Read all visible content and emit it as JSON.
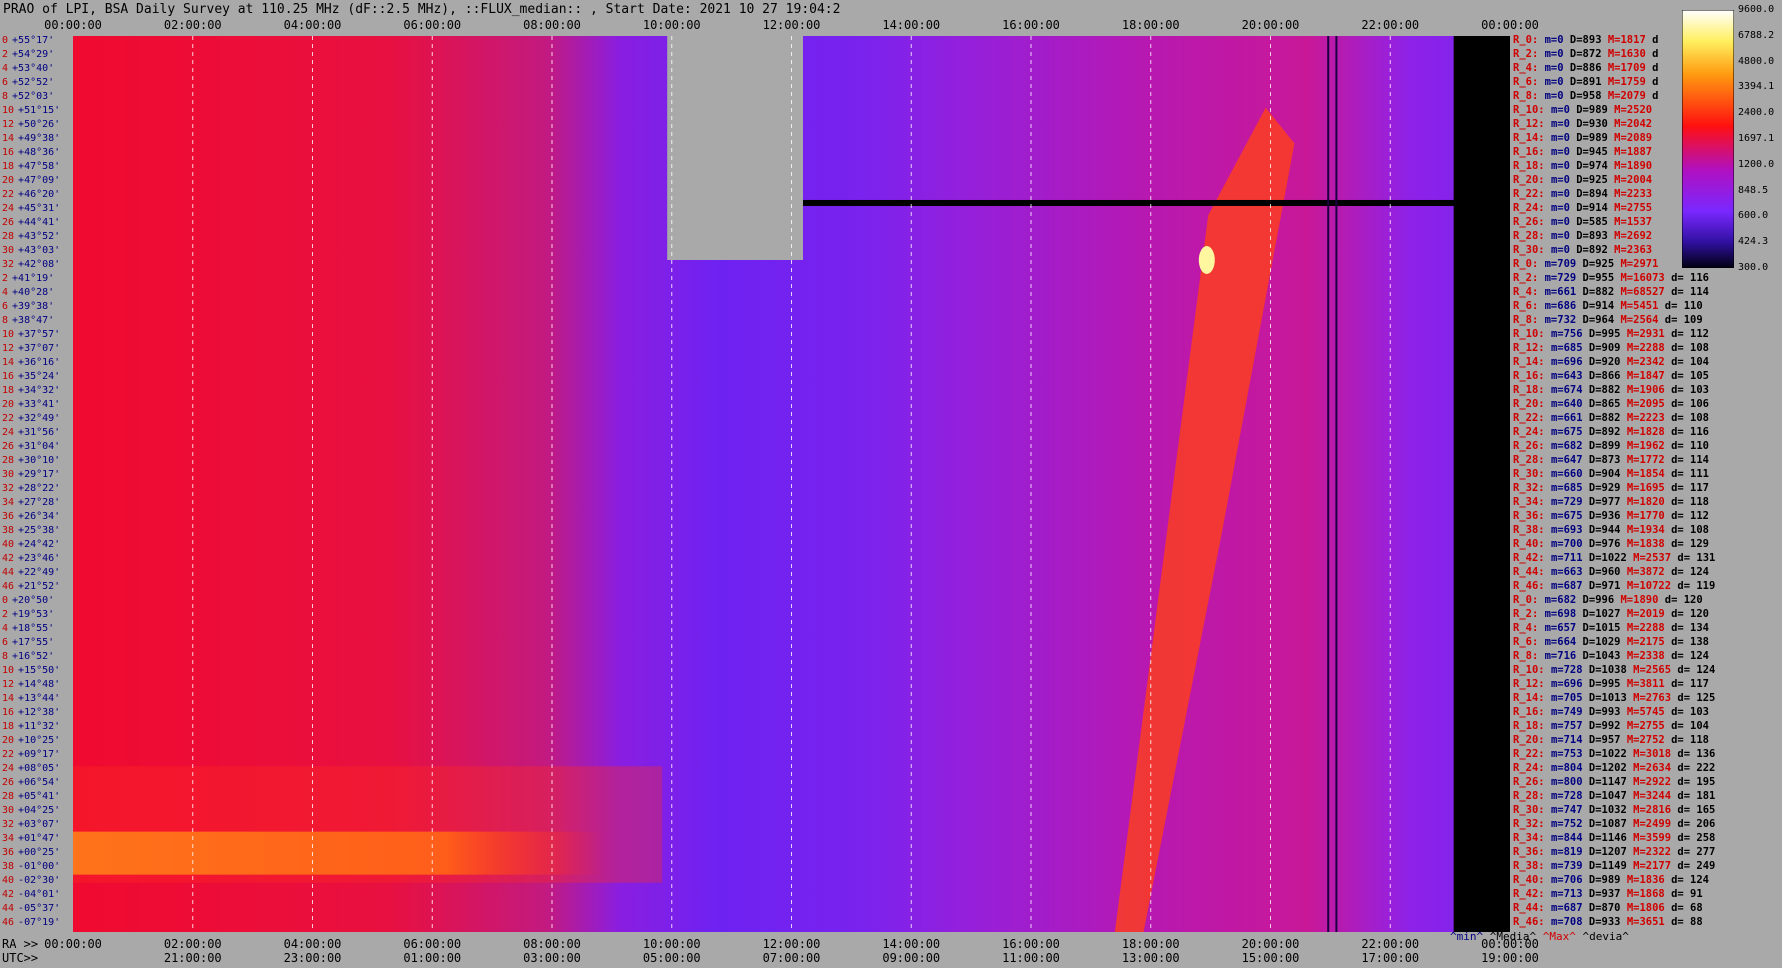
{
  "title": "PRAO of LPI, BSA Daily Survey at 110.25 MHz (dF::2.5 MHz), ::FLUX_median:: , Start Date: 2021 10 27 19:04:2",
  "bottom_left": {
    "ra": "RA >>",
    "utc": "UTC>>"
  },
  "legend_labels": {
    "min": "^min^",
    "median": "^Media^",
    "max": "^Max^",
    "dev": "^devia^"
  },
  "colorbar": {
    "ticks": [
      "9600.0",
      "6788.2",
      "4800.0",
      "3394.1",
      "2400.0",
      "1697.1",
      "1200.0",
      "848.5",
      "600.0",
      "424.3",
      "300.0"
    ]
  },
  "chart_data": {
    "type": "heatmap",
    "x_top_ticks": [
      "00:00:00",
      "02:00:00",
      "04:00:00",
      "06:00:00",
      "08:00:00",
      "10:00:00",
      "12:00:00",
      "14:00:00",
      "16:00:00",
      "18:00:00",
      "20:00:00",
      "22:00:00",
      "00:00:00"
    ],
    "x_bottom_ra_ticks": [
      "00:00:00",
      "02:00:00",
      "04:00:00",
      "06:00:00",
      "08:00:00",
      "10:00:00",
      "12:00:00",
      "14:00:00",
      "16:00:00",
      "18:00:00",
      "20:00:00",
      "22:00:00",
      "00:00:00"
    ],
    "x_bottom_utc_ticks": [
      "21:00:00",
      "23:00:00",
      "01:00:00",
      "03:00:00",
      "05:00:00",
      "07:00:00",
      "09:00:00",
      "11:00:00",
      "13:00:00",
      "15:00:00",
      "17:00:00",
      "19:00:00"
    ],
    "y_ticks": [
      {
        "i": "0",
        "dec": "+55°17'"
      },
      {
        "i": "2",
        "dec": "+54°29'"
      },
      {
        "i": "4",
        "dec": "+53°40'"
      },
      {
        "i": "6",
        "dec": "+52°52'"
      },
      {
        "i": "8",
        "dec": "+52°03'"
      },
      {
        "i": "10",
        "dec": "+51°15'"
      },
      {
        "i": "12",
        "dec": "+50°26'"
      },
      {
        "i": "14",
        "dec": "+49°38'"
      },
      {
        "i": "16",
        "dec": "+48°36'"
      },
      {
        "i": "18",
        "dec": "+47°58'"
      },
      {
        "i": "20",
        "dec": "+47°09'"
      },
      {
        "i": "22",
        "dec": "+46°20'"
      },
      {
        "i": "24",
        "dec": "+45°31'"
      },
      {
        "i": "26",
        "dec": "+44°41'"
      },
      {
        "i": "28",
        "dec": "+43°52'"
      },
      {
        "i": "30",
        "dec": "+43°03'"
      },
      {
        "i": "32",
        "dec": "+42°08'"
      },
      {
        "i": "2",
        "dec": "+41°19'"
      },
      {
        "i": "4",
        "dec": "+40°28'"
      },
      {
        "i": "6",
        "dec": "+39°38'"
      },
      {
        "i": "8",
        "dec": "+38°47'"
      },
      {
        "i": "10",
        "dec": "+37°57'"
      },
      {
        "i": "12",
        "dec": "+37°07'"
      },
      {
        "i": "14",
        "dec": "+36°16'"
      },
      {
        "i": "16",
        "dec": "+35°24'"
      },
      {
        "i": "18",
        "dec": "+34°32'"
      },
      {
        "i": "20",
        "dec": "+33°41'"
      },
      {
        "i": "22",
        "dec": "+32°49'"
      },
      {
        "i": "24",
        "dec": "+31°56'"
      },
      {
        "i": "26",
        "dec": "+31°04'"
      },
      {
        "i": "28",
        "dec": "+30°10'"
      },
      {
        "i": "30",
        "dec": "+29°17'"
      },
      {
        "i": "32",
        "dec": "+28°22'"
      },
      {
        "i": "34",
        "dec": "+27°28'"
      },
      {
        "i": "36",
        "dec": "+26°34'"
      },
      {
        "i": "38",
        "dec": "+25°38'"
      },
      {
        "i": "40",
        "dec": "+24°42'"
      },
      {
        "i": "42",
        "dec": "+23°46'"
      },
      {
        "i": "44",
        "dec": "+22°49'"
      },
      {
        "i": "46",
        "dec": "+21°52'"
      },
      {
        "i": "0",
        "dec": "+20°50'"
      },
      {
        "i": "2",
        "dec": "+19°53'"
      },
      {
        "i": "4",
        "dec": "+18°55'"
      },
      {
        "i": "6",
        "dec": "+17°55'"
      },
      {
        "i": "8",
        "dec": "+16°52'"
      },
      {
        "i": "10",
        "dec": "+15°50'"
      },
      {
        "i": "12",
        "dec": "+14°48'"
      },
      {
        "i": "14",
        "dec": "+13°44'"
      },
      {
        "i": "16",
        "dec": "+12°38'"
      },
      {
        "i": "18",
        "dec": "+11°32'"
      },
      {
        "i": "20",
        "dec": "+10°25'"
      },
      {
        "i": "22",
        "dec": "+09°17'"
      },
      {
        "i": "24",
        "dec": "+08°05'"
      },
      {
        "i": "26",
        "dec": "+06°54'"
      },
      {
        "i": "28",
        "dec": "+05°41'"
      },
      {
        "i": "30",
        "dec": "+04°25'"
      },
      {
        "i": "32",
        "dec": "+03°07'"
      },
      {
        "i": "34",
        "dec": "+01°47'"
      },
      {
        "i": "36",
        "dec": "+00°25'"
      },
      {
        "i": "38",
        "dec": "-01°00'"
      },
      {
        "i": "40",
        "dec": "-02°30'"
      },
      {
        "i": "42",
        "dec": "-04°01'"
      },
      {
        "i": "44",
        "dec": "-05°37'"
      },
      {
        "i": "46",
        "dec": "-07°19'"
      }
    ],
    "stats": [
      {
        "r": "R_0:",
        "m": "m=0",
        "d": "D=893",
        "h": "M=1817",
        "x": "d"
      },
      {
        "r": "R_2:",
        "m": "m=0",
        "d": "D=872",
        "h": "M=1630",
        "x": "d"
      },
      {
        "r": "R_4:",
        "m": "m=0",
        "d": "D=886",
        "h": "M=1709",
        "x": "d"
      },
      {
        "r": "R_6:",
        "m": "m=0",
        "d": "D=891",
        "h": "M=1759",
        "x": "d"
      },
      {
        "r": "R_8:",
        "m": "m=0",
        "d": "D=958",
        "h": "M=2079",
        "x": "d"
      },
      {
        "r": "R_10:",
        "m": "m=0",
        "d": "D=989",
        "h": "M=2520",
        "x": ""
      },
      {
        "r": "R_12:",
        "m": "m=0",
        "d": "D=930",
        "h": "M=2042",
        "x": ""
      },
      {
        "r": "R_14:",
        "m": "m=0",
        "d": "D=989",
        "h": "M=2089",
        "x": ""
      },
      {
        "r": "R_16:",
        "m": "m=0",
        "d": "D=945",
        "h": "M=1887",
        "x": ""
      },
      {
        "r": "R_18:",
        "m": "m=0",
        "d": "D=974",
        "h": "M=1890",
        "x": ""
      },
      {
        "r": "R_20:",
        "m": "m=0",
        "d": "D=925",
        "h": "M=2004",
        "x": ""
      },
      {
        "r": "R_22:",
        "m": "m=0",
        "d": "D=894",
        "h": "M=2233",
        "x": ""
      },
      {
        "r": "R_24:",
        "m": "m=0",
        "d": "D=914",
        "h": "M=2755",
        "x": ""
      },
      {
        "r": "R_26:",
        "m": "m=0",
        "d": "D=585",
        "h": "M=1537",
        "x": ""
      },
      {
        "r": "R_28:",
        "m": "m=0",
        "d": "D=893",
        "h": "M=2692",
        "x": ""
      },
      {
        "r": "R_30:",
        "m": "m=0",
        "d": "D=892",
        "h": "M=2363",
        "x": ""
      },
      {
        "r": "R_0:",
        "m": "m=709",
        "d": "D=925",
        "h": "M=2971",
        "x": ""
      },
      {
        "r": "R_2:",
        "m": "m=729",
        "d": "D=955",
        "h": "M=16073",
        "x": "d= 116"
      },
      {
        "r": "R_4:",
        "m": "m=661",
        "d": "D=882",
        "h": "M=68527",
        "x": "d= 114"
      },
      {
        "r": "R_6:",
        "m": "m=686",
        "d": "D=914",
        "h": "M=5451",
        "x": "d= 110"
      },
      {
        "r": "R_8:",
        "m": "m=732",
        "d": "D=964",
        "h": "M=2564",
        "x": "d= 109"
      },
      {
        "r": "R_10:",
        "m": "m=756",
        "d": "D=995",
        "h": "M=2931",
        "x": "d= 112"
      },
      {
        "r": "R_12:",
        "m": "m=685",
        "d": "D=909",
        "h": "M=2288",
        "x": "d= 108"
      },
      {
        "r": "R_14:",
        "m": "m=696",
        "d": "D=920",
        "h": "M=2342",
        "x": "d= 104"
      },
      {
        "r": "R_16:",
        "m": "m=643",
        "d": "D=866",
        "h": "M=1847",
        "x": "d= 105"
      },
      {
        "r": "R_18:",
        "m": "m=674",
        "d": "D=882",
        "h": "M=1906",
        "x": "d= 103"
      },
      {
        "r": "R_20:",
        "m": "m=640",
        "d": "D=865",
        "h": "M=2095",
        "x": "d= 106"
      },
      {
        "r": "R_22:",
        "m": "m=661",
        "d": "D=882",
        "h": "M=2223",
        "x": "d= 108"
      },
      {
        "r": "R_24:",
        "m": "m=675",
        "d": "D=892",
        "h": "M=1828",
        "x": "d= 116"
      },
      {
        "r": "R_26:",
        "m": "m=682",
        "d": "D=899",
        "h": "M=1962",
        "x": "d= 110"
      },
      {
        "r": "R_28:",
        "m": "m=647",
        "d": "D=873",
        "h": "M=1772",
        "x": "d= 114"
      },
      {
        "r": "R_30:",
        "m": "m=660",
        "d": "D=904",
        "h": "M=1854",
        "x": "d= 111"
      },
      {
        "r": "R_32:",
        "m": "m=685",
        "d": "D=929",
        "h": "M=1695",
        "x": "d= 117"
      },
      {
        "r": "R_34:",
        "m": "m=729",
        "d": "D=977",
        "h": "M=1820",
        "x": "d= 118"
      },
      {
        "r": "R_36:",
        "m": "m=675",
        "d": "D=936",
        "h": "M=1770",
        "x": "d= 112"
      },
      {
        "r": "R_38:",
        "m": "m=693",
        "d": "D=944",
        "h": "M=1934",
        "x": "d= 108"
      },
      {
        "r": "R_40:",
        "m": "m=700",
        "d": "D=976",
        "h": "M=1838",
        "x": "d= 129"
      },
      {
        "r": "R_42:",
        "m": "m=711",
        "d": "D=1022",
        "h": "M=2537",
        "x": "d= 131"
      },
      {
        "r": "R_44:",
        "m": "m=663",
        "d": "D=960",
        "h": "M=3872",
        "x": "d= 124"
      },
      {
        "r": "R_46:",
        "m": "m=687",
        "d": "D=971",
        "h": "M=10722",
        "x": "d= 119"
      },
      {
        "r": "R_0:",
        "m": "m=682",
        "d": "D=996",
        "h": "M=1890",
        "x": "d= 120"
      },
      {
        "r": "R_2:",
        "m": "m=698",
        "d": "D=1027",
        "h": "M=2019",
        "x": "d= 120"
      },
      {
        "r": "R_4:",
        "m": "m=657",
        "d": "D=1015",
        "h": "M=2288",
        "x": "d= 134"
      },
      {
        "r": "R_6:",
        "m": "m=664",
        "d": "D=1029",
        "h": "M=2175",
        "x": "d= 138"
      },
      {
        "r": "R_8:",
        "m": "m=716",
        "d": "D=1043",
        "h": "M=2338",
        "x": "d= 124"
      },
      {
        "r": "R_10:",
        "m": "m=728",
        "d": "D=1038",
        "h": "M=2565",
        "x": "d= 124"
      },
      {
        "r": "R_12:",
        "m": "m=696",
        "d": "D=995",
        "h": "M=3811",
        "x": "d= 117"
      },
      {
        "r": "R_14:",
        "m": "m=705",
        "d": "D=1013",
        "h": "M=2763",
        "x": "d= 125"
      },
      {
        "r": "R_16:",
        "m": "m=749",
        "d": "D=993",
        "h": "M=5745",
        "x": "d= 103"
      },
      {
        "r": "R_18:",
        "m": "m=757",
        "d": "D=992",
        "h": "M=2755",
        "x": "d= 104"
      },
      {
        "r": "R_20:",
        "m": "m=714",
        "d": "D=957",
        "h": "M=2752",
        "x": "d= 118"
      },
      {
        "r": "R_22:",
        "m": "m=753",
        "d": "D=1022",
        "h": "M=3018",
        "x": "d= 136"
      },
      {
        "r": "R_24:",
        "m": "m=804",
        "d": "D=1202",
        "h": "M=2634",
        "x": "d= 222"
      },
      {
        "r": "R_26:",
        "m": "m=800",
        "d": "D=1147",
        "h": "M=2922",
        "x": "d= 195"
      },
      {
        "r": "R_28:",
        "m": "m=728",
        "d": "D=1047",
        "h": "M=3244",
        "x": "d= 181"
      },
      {
        "r": "R_30:",
        "m": "m=747",
        "d": "D=1032",
        "h": "M=2816",
        "x": "d= 165"
      },
      {
        "r": "R_32:",
        "m": "m=752",
        "d": "D=1087",
        "h": "M=2499",
        "x": "d= 206"
      },
      {
        "r": "R_34:",
        "m": "m=844",
        "d": "D=1146",
        "h": "M=3599",
        "x": "d= 258"
      },
      {
        "r": "R_36:",
        "m": "m=819",
        "d": "D=1207",
        "h": "M=2322",
        "x": "d= 277"
      },
      {
        "r": "R_38:",
        "m": "m=739",
        "d": "D=1149",
        "h": "M=2177",
        "x": "d= 249"
      },
      {
        "r": "R_40:",
        "m": "m=706",
        "d": "D=989",
        "h": "M=1836",
        "x": "d= 124"
      },
      {
        "r": "R_42:",
        "m": "m=713",
        "d": "D=937",
        "h": "M=1868",
        "x": "d= 91"
      },
      {
        "r": "R_44:",
        "m": "m=687",
        "d": "D=870",
        "h": "M=1806",
        "x": "d= 68"
      },
      {
        "r": "R_46:",
        "m": "m=708",
        "d": "D=933",
        "h": "M=3651",
        "x": "d= 88"
      }
    ]
  }
}
